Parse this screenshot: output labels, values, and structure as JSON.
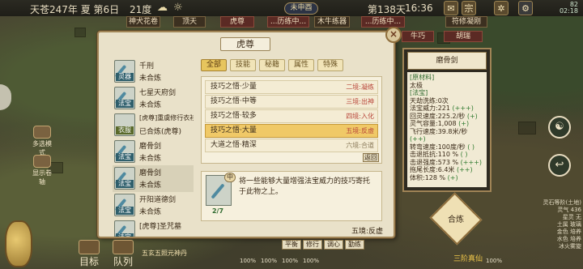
{
  "topbar": {
    "date": "天苍247年 夏 第6日",
    "temperature": "21度",
    "season_tab": "未申酉",
    "day_count": "第138天",
    "time": "16:36",
    "battery_pct": "82",
    "battery_time": "02:18"
  },
  "location_tags": [
    "神犬花卷",
    "顶天",
    "虎尊",
    "...历练中...",
    "木牛练器",
    "...历练中...",
    "符修凝刚",
    "牛巧",
    "胡瑞"
  ],
  "dialog": {
    "title": "虎尊",
    "close_label": "×",
    "tabs": [
      "全部",
      "技能",
      "秘籍",
      "属性",
      "特殊"
    ],
    "items": [
      {
        "type": "灵器",
        "name": "千刑",
        "status": "未合炼"
      },
      {
        "type": "法宝",
        "name": "七星天府剑",
        "status": "未合炼"
      },
      {
        "type": "衣服",
        "name": "[虎尊]重虞修行衣衫",
        "status": "已合炼(虎尊)"
      },
      {
        "type": "法宝",
        "name": "磨骨剑",
        "status": "未合炼"
      },
      {
        "type": "法宝",
        "name": "磨骨剑",
        "status": "未合炼"
      },
      {
        "type": "法宝",
        "name": "开阳道德剑",
        "status": "未合炼"
      },
      {
        "type": "法宝",
        "name": "[虎尊]圣咒墓",
        "status": ""
      }
    ],
    "techniques": [
      {
        "name": "技巧之悟·少量",
        "req": "二境:凝练"
      },
      {
        "name": "技巧之悟·中等",
        "req": "三境:出神"
      },
      {
        "name": "技巧之悟·较多",
        "req": "四境:入化"
      },
      {
        "name": "技巧之悟·大量",
        "req": "五境:反虚"
      },
      {
        "name": "大道之悟·精深",
        "req": "六境:合道"
      }
    ],
    "back_label": "返回",
    "desc": {
      "grade": "中",
      "count": "2/7",
      "text": "将一些能够大量增强法宝威力的技巧寄托于此物之上。",
      "realm": "五境:反虚"
    }
  },
  "item_panel": {
    "title": "磨骨剑",
    "material_tag": "[原材料]",
    "material": "太极",
    "kind_tag": "[法宝]",
    "stats": [
      {
        "label": "天劫洗练:",
        "value": "0次"
      },
      {
        "label": "法宝威力:",
        "value": "221",
        "bonus": "(+++)"
      },
      {
        "label": "回灵速度:",
        "value": "225.2/秒",
        "bonus": "(+)"
      },
      {
        "label": "灵气容量:",
        "value": "1,008",
        "bonus": "(+)"
      },
      {
        "label": "飞行速度:",
        "value": "39.8米/秒",
        "bonus": "(++)"
      },
      {
        "label": "转弯速度:",
        "value": "100度/秒",
        "bonus": "( )"
      },
      {
        "label": "击退抵抗:",
        "value": "110 %",
        "bonus": "( )"
      },
      {
        "label": "击退强度:",
        "value": "573 %",
        "bonus": "(+++)"
      },
      {
        "label": "拖尾长度:",
        "value": "6.4米",
        "bonus": "(++)"
      },
      {
        "label": "体积:",
        "value": "128 %",
        "bonus": "(+)"
      }
    ]
  },
  "side_buttons": [
    "多选模式",
    "显示卷轴"
  ],
  "bottom": {
    "goal": "目标",
    "team": "队列",
    "boxes": [
      "平衡",
      "修行",
      "调心",
      "勤练"
    ],
    "craft": "合炼",
    "marquee": "五玄五照元神丹",
    "ai": "三阶真仙",
    "pcts": [
      "100%",
      "100%",
      "100%",
      "100%",
      "100%"
    ]
  },
  "right_info": [
    "灵石等阶(土地)",
    "灵气 436",
    "星灵 无",
    "土属 玻璃",
    "金色 培养",
    "水色 培养",
    "冰火雾旋"
  ],
  "colors": {
    "panel_bg": "#e9e1c9",
    "accent_gold": "#e7c55e",
    "selected_tech": "#f0c967",
    "requirement_red": "#b8463a"
  }
}
